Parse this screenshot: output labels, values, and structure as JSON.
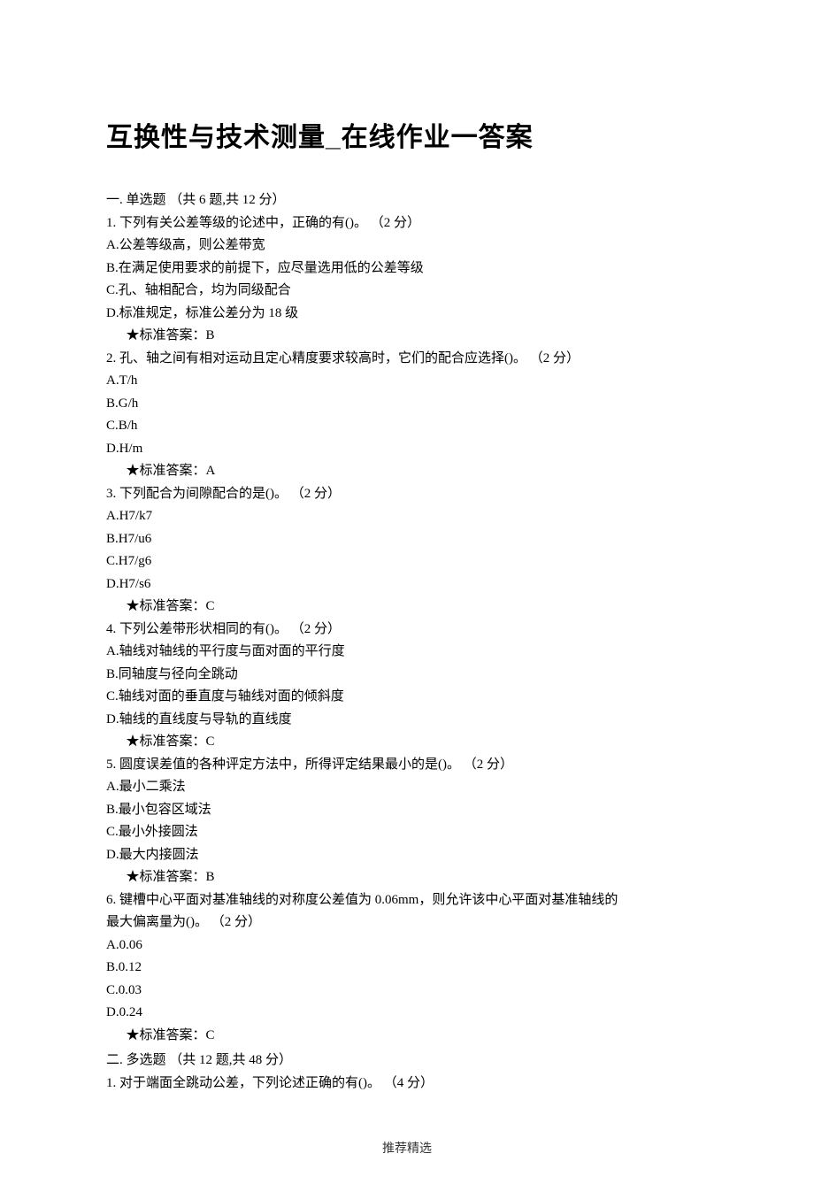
{
  "title": "互换性与技术测量_在线作业一答案",
  "section1": {
    "heading": "一.  单选题  （共 6 题,共 12 分）",
    "questions": [
      {
        "num": "1.",
        "text": "下列有关公差等级的论述中，正确的有()。  （2 分）",
        "options": [
          "A.公差等级高，则公差带宽",
          "B.在满足使用要求的前提下，应尽量选用低的公差等级",
          "C.孔、轴相配合，均为同级配合",
          "D.标准规定，标准公差分为 18 级"
        ],
        "answer": "★标准答案：B"
      },
      {
        "num": "2.",
        "text": "孔、轴之间有相对运动且定心精度要求较高时，它们的配合应选择()。  （2 分）",
        "options": [
          "A.T/h",
          "B.G/h",
          "C.B/h",
          "D.H/m"
        ],
        "answer": "★标准答案：A"
      },
      {
        "num": "3.",
        "text": "下列配合为间隙配合的是()。  （2 分）",
        "options": [
          "A.H7/k7",
          "B.H7/u6",
          "C.H7/g6",
          "D.H7/s6"
        ],
        "answer": "★标准答案：C"
      },
      {
        "num": "4.",
        "text": "下列公差带形状相同的有()。  （2 分）",
        "options": [
          "A.轴线对轴线的平行度与面对面的平行度",
          "B.同轴度与径向全跳动",
          "C.轴线对面的垂直度与轴线对面的倾斜度",
          "D.轴线的直线度与导轨的直线度"
        ],
        "answer": "★标准答案：C"
      },
      {
        "num": "5.",
        "text": "圆度误差值的各种评定方法中，所得评定结果最小的是()。  （2 分）",
        "options": [
          "A.最小二乘法",
          "B.最小包容区域法",
          "C.最小外接圆法",
          "D.最大内接圆法"
        ],
        "answer": "★标准答案：B"
      },
      {
        "num": "6.",
        "text": "键槽中心平面对基准轴线的对称度公差值为 0.06mm，则允许该中心平面对基准轴线的",
        "text2": "最大偏离量为()。  （2 分）",
        "options": [
          "A.0.06",
          "B.0.12",
          "C.0.03",
          "D.0.24"
        ],
        "answer": "★标准答案：C"
      }
    ]
  },
  "section2": {
    "heading": "二.  多选题  （共 12 题,共 48 分）",
    "questions": [
      {
        "num": "1.",
        "text": "对于端面全跳动公差，下列论述正确的有()。  （4 分）"
      }
    ]
  },
  "footer": "推荐精选"
}
